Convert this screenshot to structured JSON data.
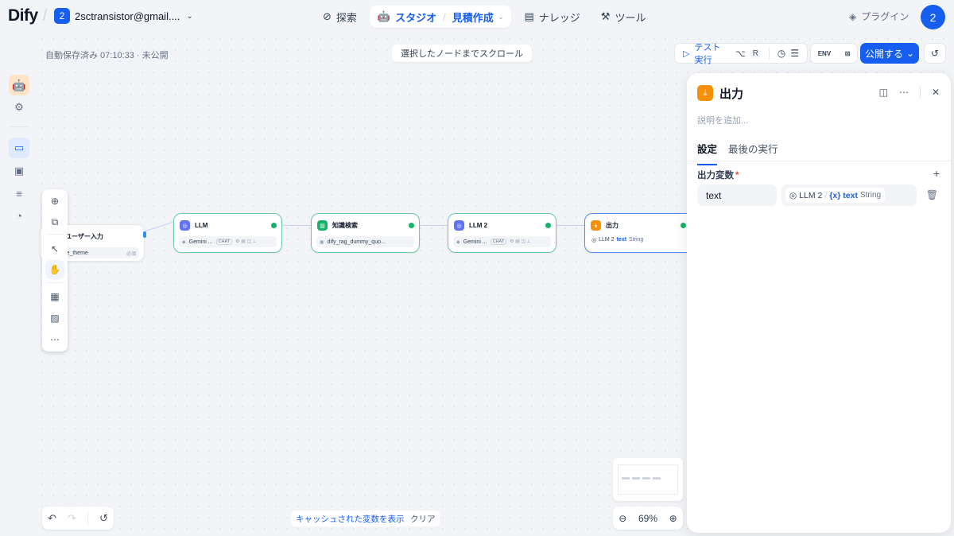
{
  "app": {
    "logo": "Dify",
    "workspace_badge": "2",
    "workspace_name": "2sctransistor@gmail...."
  },
  "nav": {
    "explore": "探索",
    "studio": "スタジオ",
    "studio_app": "見積作成",
    "knowledge": "ナレッジ",
    "tools": "ツール"
  },
  "header": {
    "plugins": "プラグイン",
    "avatar": "2"
  },
  "canvas": {
    "autosave": "自動保存済み 07:10:33 · 未公開",
    "scroll_to_node": "選択したノードまでスクロール",
    "test_run": "テスト実行",
    "test_run_key1": "⌥",
    "test_run_key2": "R",
    "env": "ENV",
    "publish": "公開する",
    "show_cached": "キャッシュされた変数を表示",
    "clear": "クリア",
    "zoom": "69%"
  },
  "nodes": {
    "start": {
      "title": "ユーザー入力",
      "var": "estimate_theme",
      "req": "必須"
    },
    "llm1": {
      "title": "LLM",
      "model": "Gemini ...",
      "mode": "CHAT"
    },
    "kb": {
      "title": "知識検索",
      "dataset": "dify_rag_dummy_quo..."
    },
    "llm2": {
      "title": "LLM 2",
      "model": "Gemini ...",
      "mode": "CHAT"
    },
    "out": {
      "title": "出力",
      "src": "LLM 2",
      "var": "text",
      "type": "String"
    }
  },
  "panel": {
    "title": "出力",
    "desc_placeholder": "説明を追加...",
    "tabs": [
      "設定",
      "最後の実行"
    ],
    "output_vars_label": "出力変数",
    "required_mark": "*",
    "var_name": "text",
    "ref_node": "LLM 2",
    "ref_var": "text",
    "ref_type": "String"
  },
  "colors": {
    "accent": "#155eef",
    "success": "#17b26a",
    "output": "#f79009",
    "llm": "#6172f3"
  }
}
